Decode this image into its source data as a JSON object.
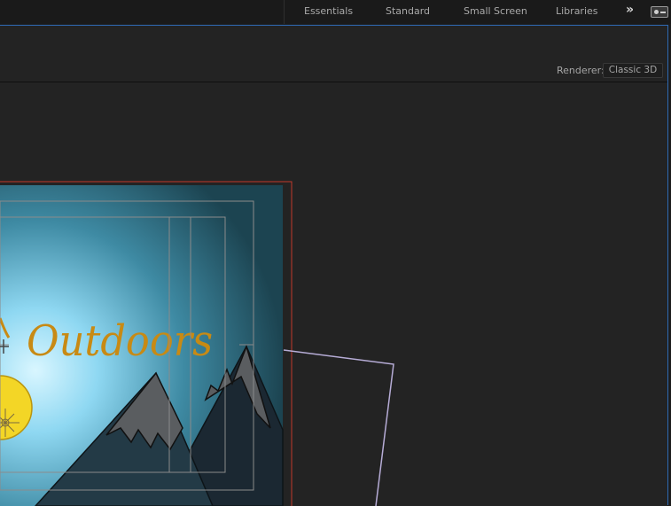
{
  "workspaces": {
    "tabs": [
      "Essentials",
      "Standard",
      "Small Screen",
      "Libraries"
    ],
    "more_glyph": "»"
  },
  "composition_panel": {
    "renderer_label": "Renderer:",
    "renderer_value": "Classic 3D"
  },
  "artwork": {
    "title_text": "Outdoors",
    "colors": {
      "sky_center": "#a9e6f7",
      "sky_edge": "#1c4451",
      "sun": "#f3d626",
      "title": "#c88a14",
      "mountain_front": "#5a5d60",
      "mountain_back": "#1b2832",
      "comp_border": "#c0392b",
      "guide": "#8b8b8b",
      "camera_outline": "#b6acd6"
    }
  }
}
